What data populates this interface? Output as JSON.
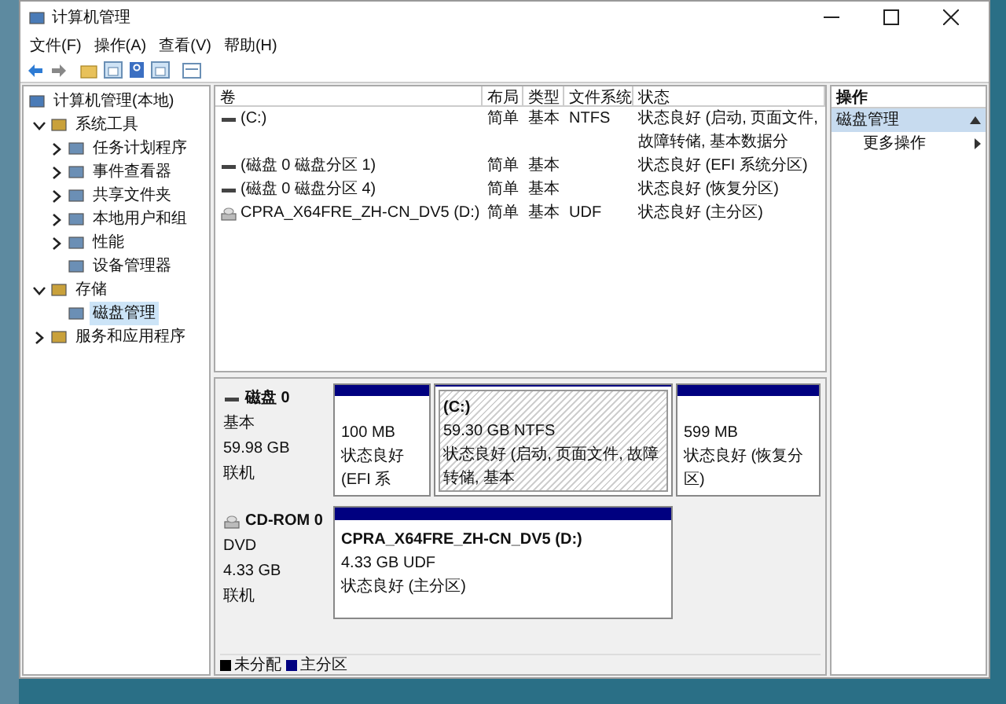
{
  "window": {
    "title": "计算机管理"
  },
  "menu": [
    "文件(F)",
    "操作(A)",
    "查看(V)",
    "帮助(H)"
  ],
  "tree": [
    {
      "label": "计算机管理(本地)",
      "kind": "root",
      "selected": false,
      "children": [
        {
          "label": "系统工具",
          "kind": "group",
          "expanded": true,
          "selected": false,
          "children": [
            {
              "label": "任务计划程序",
              "kind": "group",
              "expanded": false,
              "selected": false
            },
            {
              "label": "事件查看器",
              "kind": "group",
              "expanded": false,
              "selected": false
            },
            {
              "label": "共享文件夹",
              "kind": "group",
              "expanded": false,
              "selected": false
            },
            {
              "label": "本地用户和组",
              "kind": "group",
              "expanded": false,
              "selected": false
            },
            {
              "label": "性能",
              "kind": "group",
              "expanded": false,
              "selected": false
            },
            {
              "label": "设备管理器",
              "kind": "leaf",
              "selected": false
            }
          ]
        },
        {
          "label": "存储",
          "kind": "group",
          "expanded": true,
          "selected": false,
          "children": [
            {
              "label": "磁盘管理",
              "kind": "leaf",
              "selected": true
            }
          ]
        },
        {
          "label": "服务和应用程序",
          "kind": "group",
          "expanded": false,
          "selected": false
        }
      ]
    }
  ],
  "table": {
    "columns": [
      "卷",
      "布局",
      "类型",
      "文件系统",
      "状态"
    ],
    "rows": [
      {
        "kind": "partition",
        "cells": [
          "(C:)",
          "简单",
          "基本",
          "NTFS",
          "状态良好 (启动, 页面文件, 故障转储, 基本数据分"
        ]
      },
      {
        "kind": "partition",
        "cells": [
          "(磁盘 0 磁盘分区 1)",
          "简单",
          "基本",
          "",
          "状态良好 (EFI 系统分区)"
        ]
      },
      {
        "kind": "partition",
        "cells": [
          "(磁盘 0 磁盘分区 4)",
          "简单",
          "基本",
          "",
          "状态良好 (恢复分区)"
        ]
      },
      {
        "kind": "cdrom",
        "cells": [
          "CPRA_X64FRE_ZH-CN_DV5 (D:)",
          "简单",
          "基本",
          "UDF",
          "状态良好 (主分区)"
        ]
      }
    ]
  },
  "disks": [
    {
      "kind": "disk",
      "name": "磁盘 0",
      "type": "基本",
      "size": "59.98 GB",
      "status": "联机",
      "partitions": [
        {
          "size": "100 MB",
          "status": "状态良好 (EFI 系",
          "selected": false
        },
        {
          "title": "(C:)",
          "size": "59.30 GB NTFS",
          "status": "状态良好 (启动, 页面文件, 故障转储, 基本",
          "selected": true
        },
        {
          "size": "599 MB",
          "status": "状态良好 (恢复分区)",
          "selected": false
        }
      ]
    },
    {
      "kind": "cdrom",
      "name": "CD-ROM 0",
      "type": "DVD",
      "size": "4.33 GB",
      "status": "联机",
      "partitions": [
        {
          "title": "CPRA_X64FRE_ZH-CN_DV5  (D:)",
          "size": "4.33 GB UDF",
          "status": "状态良好 (主分区)",
          "selected": false
        }
      ]
    }
  ],
  "legend": [
    {
      "label": "未分配",
      "color": "#000000"
    },
    {
      "label": "主分区",
      "color": "#000080"
    }
  ],
  "actions": {
    "header": "操作",
    "section": {
      "label": "磁盘管理",
      "expanded": true
    },
    "items": [
      "更多操作"
    ]
  }
}
